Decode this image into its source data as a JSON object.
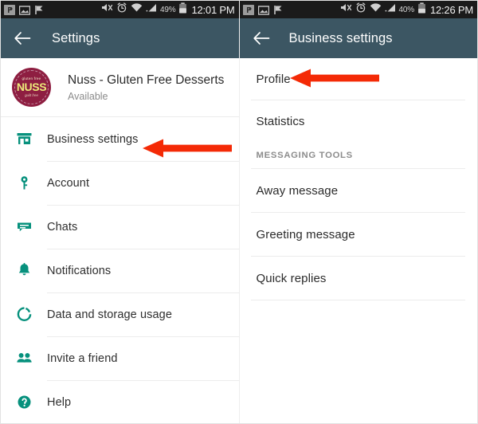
{
  "meta": {
    "accent_teal": "#07917d",
    "appbar_color": "#3c5663",
    "statusbar_color": "#1b1b1b",
    "arrow_color": "#f42a06",
    "avatar_bg": "#8e1e41"
  },
  "left_pane": {
    "statusbar": {
      "notification_icons": [
        "app-badge-icon",
        "screenshot-icon",
        "flag-icon"
      ],
      "mute_icon": "mute-icon",
      "alarm_icon": "alarm-clock-icon",
      "wifi_icon": "wifi-icon",
      "signal_icon": "cellular-signal-icon",
      "battery_percent": "49%",
      "battery_icon": "battery-icon",
      "clock": "12:01 PM"
    },
    "appbar": {
      "back_icon": "back-arrow-icon",
      "title": "Settings"
    },
    "profile": {
      "avatar_top_text": "gluten free",
      "avatar_main_text": "NUSS",
      "avatar_bottom_text": "guilt free",
      "name": "Nuss - Gluten Free Desserts",
      "status": "Available"
    },
    "menu": [
      {
        "label": "Business settings",
        "icon": "store-icon"
      },
      {
        "label": "Account",
        "icon": "key-icon"
      },
      {
        "label": "Chats",
        "icon": "chat-bubble-icon"
      },
      {
        "label": "Notifications",
        "icon": "bell-icon"
      },
      {
        "label": "Data and storage usage",
        "icon": "data-usage-icon"
      },
      {
        "label": "Invite a friend",
        "icon": "people-icon"
      },
      {
        "label": "Help",
        "icon": "help-circle-icon"
      }
    ],
    "annotation": {
      "name": "red-arrow-business-settings"
    }
  },
  "right_pane": {
    "statusbar": {
      "notification_icons": [
        "app-badge-icon",
        "screenshot-icon",
        "flag-icon"
      ],
      "mute_icon": "mute-icon",
      "alarm_icon": "alarm-clock-icon",
      "wifi_icon": "wifi-icon",
      "signal_icon": "cellular-signal-icon",
      "battery_percent": "40%",
      "battery_icon": "battery-icon",
      "clock": "12:26 PM"
    },
    "appbar": {
      "back_icon": "back-arrow-icon",
      "title": "Business settings"
    },
    "items_top": [
      {
        "label": "Profile"
      },
      {
        "label": "Statistics"
      }
    ],
    "section_title": "MESSAGING TOOLS",
    "items_messaging": [
      {
        "label": "Away message"
      },
      {
        "label": "Greeting message"
      },
      {
        "label": "Quick replies"
      }
    ],
    "annotation": {
      "name": "red-arrow-profile"
    }
  }
}
